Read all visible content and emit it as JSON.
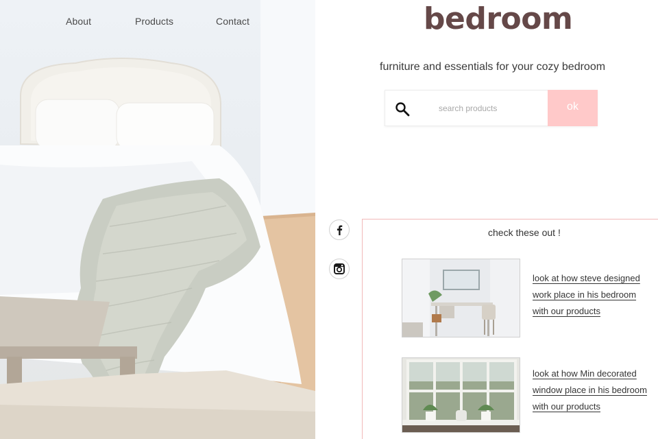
{
  "nav": {
    "items": [
      {
        "label": "About"
      },
      {
        "label": "Products"
      },
      {
        "label": "Contact"
      }
    ]
  },
  "brand": {
    "title": "bedroom"
  },
  "tagline": "furniture and essentials for your cozy bedroom",
  "search": {
    "placeholder": "search products",
    "button_label": "ok",
    "icon": "search-icon"
  },
  "social": [
    {
      "icon": "facebook-icon"
    },
    {
      "icon": "instagram-icon"
    }
  ],
  "featured": {
    "title": "check these out !",
    "items": [
      {
        "link_text": "look at how steve designed work place in his bedroom with our products"
      },
      {
        "link_text": "look at how Min decorated window place in his bedroom with our products"
      }
    ]
  },
  "colors": {
    "brand": "#654848",
    "button_bg": "#ffc9c9",
    "panel_border": "#f1b9b9"
  }
}
